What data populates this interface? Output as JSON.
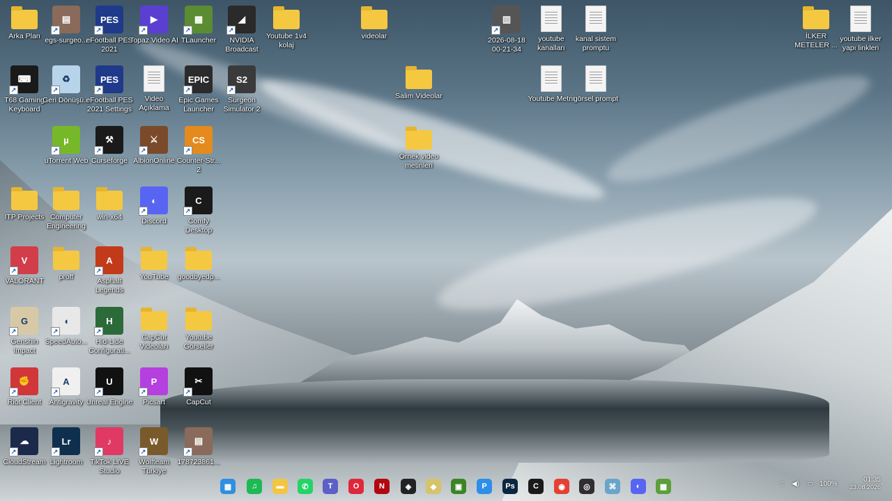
{
  "desktop": {
    "icons": [
      {
        "label": "Arka Plan",
        "icon": "folder-icon"
      },
      {
        "label": "egs-surgeo...",
        "icon": "image-thumbnail-icon"
      },
      {
        "label": "eFootball PES 2021",
        "icon": "efootball-icon"
      },
      {
        "label": "Topaz Video AI",
        "icon": "topaz-icon"
      },
      {
        "label": "TLauncher",
        "icon": "tlauncher-icon"
      },
      {
        "label": "NVIDIA Broadcast",
        "icon": "nvidia-broadcast-icon"
      },
      {
        "label": "Youtube 1v4 kolaj",
        "icon": "folder-icon"
      },
      {
        "label": "videolar",
        "icon": "folder-icon"
      },
      {
        "label": "2026-08-18 00-21-34",
        "icon": "video-file-icon"
      },
      {
        "label": "youtube kanalları",
        "icon": "text-document-icon"
      },
      {
        "label": "kanal sistem promptu",
        "icon": "text-document-icon"
      },
      {
        "label": "İLKER METELER ...",
        "icon": "folder-icon"
      },
      {
        "label": "youtube ilker yapı linkleri",
        "icon": "text-document-icon"
      },
      {
        "label": "T68 Gaming Keyboard",
        "icon": "keyboard-icon"
      },
      {
        "label": "Geri Dönüşü...",
        "icon": "recycle-bin-icon"
      },
      {
        "label": "eFootball PES 2021 Settings",
        "icon": "efootball-settings-icon"
      },
      {
        "label": "Video Açıklama",
        "icon": "text-document-icon"
      },
      {
        "label": "Epic Games Launcher",
        "icon": "epic-games-icon"
      },
      {
        "label": "Surgeon Simulator 2",
        "icon": "surgeon-simulator-icon"
      },
      {
        "label": "Salim Videolar",
        "icon": "folder-icon"
      },
      {
        "label": "Youtube Metni",
        "icon": "text-document-icon"
      },
      {
        "label": "görsel prompt",
        "icon": "text-document-icon"
      },
      {
        "label": "uTorrent Web",
        "icon": "utorrent-icon"
      },
      {
        "label": "Curseforge",
        "icon": "curseforge-icon"
      },
      {
        "label": "AlbionOnline",
        "icon": "albion-online-icon"
      },
      {
        "label": "Counter-Str... 2",
        "icon": "counter-strike-icon"
      },
      {
        "label": "Örnek video metinleri",
        "icon": "folder-icon"
      },
      {
        "label": "ITP Projects",
        "icon": "folder-icon"
      },
      {
        "label": "Computer Engineering",
        "icon": "folder-icon"
      },
      {
        "label": "win-x64",
        "icon": "folder-icon"
      },
      {
        "label": "Discord",
        "icon": "discord-icon"
      },
      {
        "label": "Comfy Desktop",
        "icon": "comfy-icon"
      },
      {
        "label": "VALORANT",
        "icon": "valorant-icon"
      },
      {
        "label": "proff",
        "icon": "folder-icon"
      },
      {
        "label": "Asphalt Legends",
        "icon": "asphalt-icon"
      },
      {
        "label": "YouTube",
        "icon": "folder-icon"
      },
      {
        "label": "goodbyedp...",
        "icon": "folder-icon"
      },
      {
        "label": "Genshin Impact",
        "icon": "genshin-icon"
      },
      {
        "label": "SpeedAuto...",
        "icon": "mouse-icon"
      },
      {
        "label": "Hid-Lide Configurati...",
        "icon": "hid-config-icon"
      },
      {
        "label": "CapCut Videoları",
        "icon": "folder-icon"
      },
      {
        "label": "Youtube Görseller",
        "icon": "folder-icon"
      },
      {
        "label": "Riot Client",
        "icon": "riot-client-icon"
      },
      {
        "label": "Antigravity",
        "icon": "antigravity-icon"
      },
      {
        "label": "Unreal Engine",
        "icon": "unreal-engine-icon"
      },
      {
        "label": "Picsart",
        "icon": "picsart-icon"
      },
      {
        "label": "CapCut",
        "icon": "capcut-icon"
      },
      {
        "label": "CloudStream",
        "icon": "cloudstream-icon"
      },
      {
        "label": "Lightroom",
        "icon": "lightroom-icon"
      },
      {
        "label": "TikTok LIVE Studio",
        "icon": "tiktok-live-icon"
      },
      {
        "label": "Wolfteam Türkiye",
        "icon": "wolfteam-icon"
      },
      {
        "label": "178723861...",
        "icon": "image-thumbnail-icon"
      }
    ]
  },
  "taskbar": {
    "apps": [
      {
        "name": "start-button",
        "glyph": "▦",
        "color": "#2f8fe0"
      },
      {
        "name": "spotify-taskbar-icon",
        "glyph": "♫",
        "color": "#1db954"
      },
      {
        "name": "file-explorer-taskbar-icon",
        "glyph": "▬",
        "color": "#f2c641"
      },
      {
        "name": "whatsapp-taskbar-icon",
        "glyph": "✆",
        "color": "#25d366"
      },
      {
        "name": "teams-taskbar-icon",
        "glyph": "T",
        "color": "#5b5fc7"
      },
      {
        "name": "opera-taskbar-icon",
        "glyph": "O",
        "color": "#e0283b"
      },
      {
        "name": "netflix-taskbar-icon",
        "glyph": "N",
        "color": "#b20710"
      },
      {
        "name": "capcut-taskbar-icon",
        "glyph": "◈",
        "color": "#222"
      },
      {
        "name": "shield-app-taskbar-icon",
        "glyph": "◆",
        "color": "#d6c36a"
      },
      {
        "name": "minecraft-taskbar-icon",
        "glyph": "▣",
        "color": "#3c8527"
      },
      {
        "name": "pycharm-taskbar-icon",
        "glyph": "P",
        "color": "#2e8ee8"
      },
      {
        "name": "photoshop-taskbar-icon",
        "glyph": "Ps",
        "color": "#0b2640"
      },
      {
        "name": "comfy-taskbar-icon",
        "glyph": "C",
        "color": "#1a1a1a"
      },
      {
        "name": "chrome-taskbar-icon",
        "glyph": "◉",
        "color": "#e34133"
      },
      {
        "name": "obs-taskbar-icon",
        "glyph": "◎",
        "color": "#302e31"
      },
      {
        "name": "network-tool-taskbar-icon",
        "glyph": "⌘",
        "color": "#6aa4c9"
      },
      {
        "name": "discord-taskbar-icon",
        "glyph": "◐",
        "color": "#5865f2"
      },
      {
        "name": "minecraft-launcher-taskbar-icon",
        "glyph": "▩",
        "color": "#5c9e3a"
      }
    ],
    "battery": "100%",
    "time": "01:35",
    "date": "23.08.2026"
  }
}
